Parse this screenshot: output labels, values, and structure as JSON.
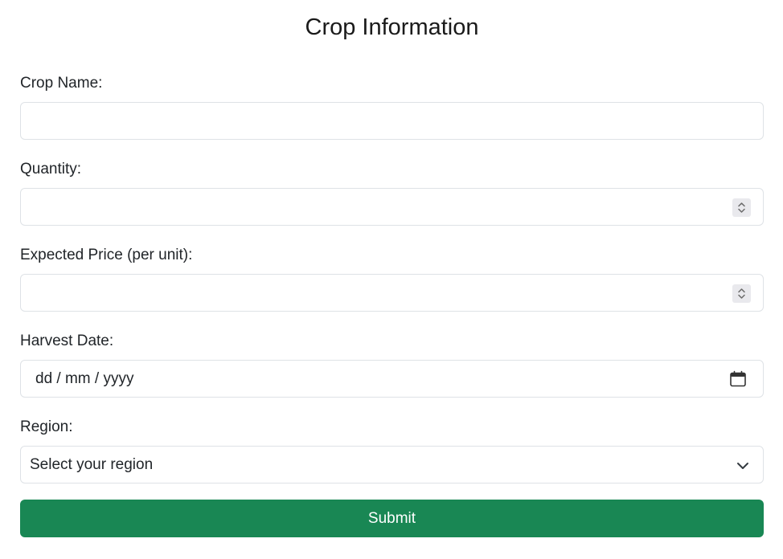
{
  "form": {
    "title": "Crop Information",
    "crop_name": {
      "label": "Crop Name:",
      "value": ""
    },
    "quantity": {
      "label": "Quantity:",
      "value": ""
    },
    "price": {
      "label": "Expected Price (per unit):",
      "value": ""
    },
    "harvest_date": {
      "label": "Harvest Date:",
      "placeholder": "dd / mm / yyyy"
    },
    "region": {
      "label": "Region:",
      "selected": "Select your region"
    },
    "submit_label": "Submit"
  },
  "icons": {
    "spinner": "number-spinner-icon",
    "calendar": "calendar-icon",
    "dropdown": "chevron-down-icon"
  },
  "colors": {
    "submit_bg": "#198754",
    "border": "#dee2e6"
  }
}
